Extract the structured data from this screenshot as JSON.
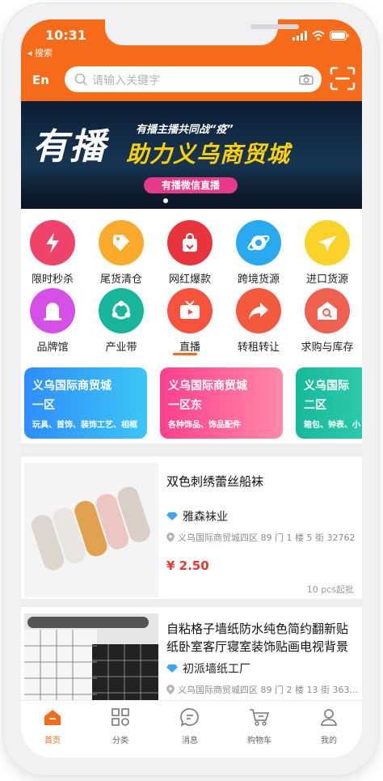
{
  "status": {
    "time": "31",
    "back_label": "◂ 搜索",
    "time_prefix": "10:"
  },
  "header": {
    "lang_button": "En",
    "search_placeholder": "请输入关键字"
  },
  "banner": {
    "headline": "有播",
    "tagline": "有播主播共同战“疫”",
    "subheadline": "助力义乌商贸城",
    "cta": "有播微信直播"
  },
  "categories": [
    {
      "label": "限时秒杀",
      "icon": "lightning-icon",
      "color": "#f0436a"
    },
    {
      "label": "尾货清仓",
      "icon": "price-tag-icon",
      "color": "#fbab2c"
    },
    {
      "label": "网红爆款",
      "icon": "shopping-bag-icon",
      "color": "#e8343c"
    },
    {
      "label": "跨境货源",
      "icon": "globe-icon",
      "color": "#29a9ef"
    },
    {
      "label": "进口货源",
      "icon": "airplane-icon",
      "color": "#fbd22a"
    },
    {
      "label": "品牌馆",
      "icon": "brand-hall-icon",
      "color": "#d64fe6"
    },
    {
      "label": "产业带",
      "icon": "industry-belt-icon",
      "color": "#17b59a"
    },
    {
      "label": "直播",
      "icon": "tv-icon",
      "color": "#f5533e"
    },
    {
      "label": "转租转让",
      "icon": "share-arrow-icon",
      "color": "#f25a3c"
    },
    {
      "label": "求购与库存",
      "icon": "warehouse-search-icon",
      "color": "#f0604e"
    }
  ],
  "zones": [
    {
      "title": "义乌国际商贸城",
      "district": "一区",
      "desc": "玩具、首饰、装饰工艺、相框",
      "color1": "#2f8dfd",
      "color2": "#3cc6f5"
    },
    {
      "title": "义乌国际商贸城",
      "district": "一区东",
      "desc": "各种饰品、饰品配件",
      "color1": "#ff3f8e",
      "color2": "#ff8aa8"
    },
    {
      "title": "义乌国际",
      "district": "二区",
      "desc": "箱包、钟表、小",
      "color1": "#18b99b",
      "color2": "#3ad7b7"
    }
  ],
  "products": [
    {
      "title": "双色刺绣蕾丝船袜",
      "shop": "雅森袜业",
      "address": "义乌国际商贸城四区 89 门 1 楼 5 街 32762",
      "price": "¥ 2.50",
      "moq": "10 pcs起批"
    },
    {
      "title": "自粘格子墙纸防水纯色简约翻新贴纸卧室客厅寝室装饰贴画电视背景",
      "shop": "初派墙纸工厂",
      "address": "义乌国际商贸城四区 89 门 2 楼 13 街 363..."
    }
  ],
  "tabbar": [
    {
      "label": "首页",
      "icon": "home-icon",
      "active": true
    },
    {
      "label": "分类",
      "icon": "category-grid-icon"
    },
    {
      "label": "消息",
      "icon": "message-icon"
    },
    {
      "label": "购物车",
      "icon": "cart-icon"
    },
    {
      "label": "我的",
      "icon": "profile-icon"
    }
  ],
  "colors": {
    "brand": "#f56b1a",
    "price": "#e8382d"
  }
}
